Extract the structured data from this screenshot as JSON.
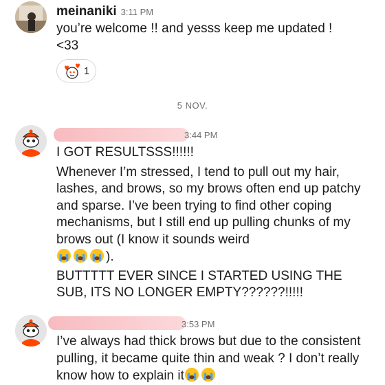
{
  "messages": [
    {
      "username": "meinaniki",
      "time": "3:11 PM",
      "lines": [
        "you’re welcome !! and yesss keep me updated !",
        "<33"
      ],
      "reaction": {
        "icon": "heart-snoo-icon",
        "count": "1"
      }
    },
    {
      "username": "",
      "time": "3:44 PM",
      "paragraphs": [
        "I GOT RESULTSSS!!!!!!",
        "Whenever I’m stressed, I tend to pull out my hair, lashes, and brows, so my brows often end up patchy and sparse. I’ve been trying to find other coping mechanisms, but I still end up pulling chunks of my brows out (I know it sounds weird",
        ").",
        "BUTTTTT EVER SINCE I STARTED USING THE SUB, ITS NO LONGER EMPTY??????!!!!!"
      ],
      "emoji_count": 3
    },
    {
      "username": "",
      "time": "3:53 PM",
      "paragraphs": [
        "I’ve always had thick brows but due to the consistent pulling, it became quite thin and weak ? I don’t really know how to explain it"
      ]
    }
  ],
  "date_separator": "5 NOV.",
  "colors": {
    "redaction": "#f6b0b4",
    "avatar_orange": "#ff4500",
    "meta": "#6f6f6f"
  }
}
